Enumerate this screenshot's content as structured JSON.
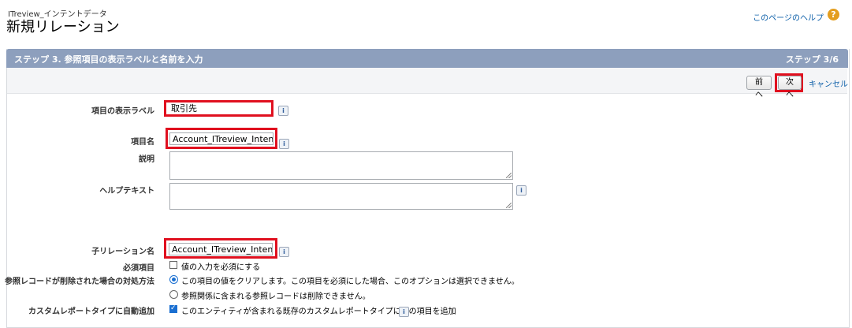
{
  "header": {
    "breadcrumb": "ITreview_インテントデータ",
    "title": "新規リレーション",
    "help_link": "このページのヘルプ",
    "help_icon": "?"
  },
  "step": {
    "title": "ステップ 3. 参照項目の表示ラベルと名前を入力",
    "counter": "ステップ 3/6"
  },
  "toolbar": {
    "prev_label": "前へ",
    "next_label": "次へ",
    "cancel_label": "キャンセル"
  },
  "form": {
    "field_label": {
      "label": "項目の表示ラベル",
      "value": "取引先"
    },
    "field_name": {
      "label": "項目名",
      "value": "Account_ITreview_IntentD"
    },
    "description": {
      "label": "説明",
      "value": ""
    },
    "help_text": {
      "label": "ヘルプテキスト",
      "value": ""
    },
    "child_relation": {
      "label": "子リレーション名",
      "value": "Account_ITreview_IntentD"
    },
    "required": {
      "label": "必須項目",
      "option": "値の入力を必須にする",
      "checked": false
    },
    "on_delete": {
      "label": "参照レコードが削除された場合の対処方法",
      "option_clear": "この項目の値をクリアします。この項目を必須にした場合、このオプションは選択できません。",
      "option_restrict": "参照関係に含まれる参照レコードは削除できません。",
      "selected": "option_clear"
    },
    "report_type": {
      "label": "カスタムレポートタイプに自動追加",
      "option": "このエンティティが含まれる既存のカスタムレポートタイプにこの項目を追加",
      "checked": true
    },
    "info_icon": "i"
  },
  "colors": {
    "step_bar": "#8d9fbd",
    "highlight": "#e0101f",
    "link": "#0b5ea8",
    "help_icon": "#e49e1f"
  }
}
